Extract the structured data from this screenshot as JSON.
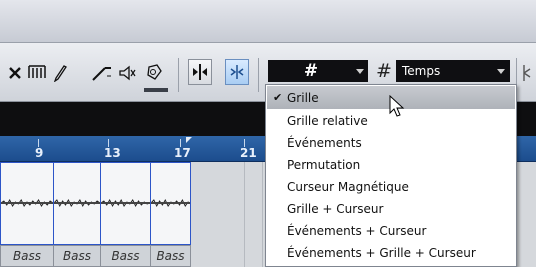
{
  "toolbar": {
    "snap_label": "#",
    "quantize_label": "#",
    "quantize_value": "Temps"
  },
  "timeline": {
    "markers": [
      "9",
      "13",
      "17",
      "21"
    ]
  },
  "track": {
    "event_name": "Bass",
    "events": [
      "Bass",
      "Bass",
      "Bass",
      "Bass"
    ]
  },
  "snap_menu": {
    "selected": "Grille",
    "items": [
      "Grille",
      "Grille relative",
      "Événements",
      "Permutation",
      "Curseur Magnétique",
      "Grille + Curseur",
      "Événements + Curseur",
      "Événements + Grille + Curseur"
    ]
  },
  "colors": {
    "timeline_blue": "#2a5fa0",
    "event_border": "#2d55c8",
    "toggle_active": "#a9cdf3"
  }
}
